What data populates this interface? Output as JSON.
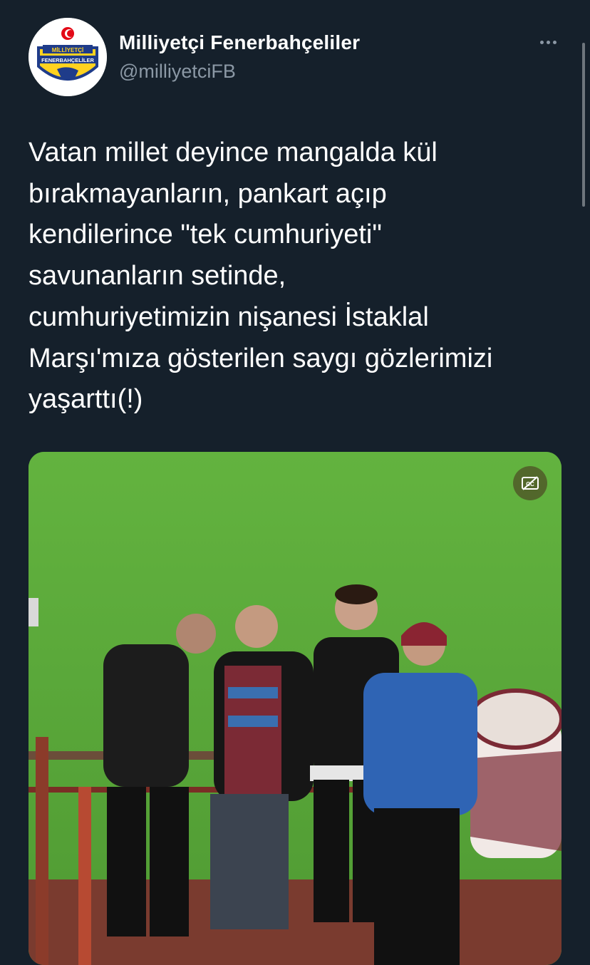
{
  "author": {
    "display_name": "Milliyetçi Fenerbahçeliler",
    "handle": "@milliyetciFB",
    "avatar_text_top": "MİLLİYETÇİ",
    "avatar_text_band": "FENERBAHÇELİLER"
  },
  "tweet": {
    "text": "Vatan millet deyince mangalda kül\nbırakmayanların, pankart açıp\nkendilerince \"tek cumhuriyeti\"\nsavunanların setinde,\ncumhuriyetimizin nişanesi İstaklal\nMarşı'mıza gösterilen saygı gözlerimizi\nyaşarttı(!)"
  },
  "icons": {
    "more": "more-horizontal-icon",
    "captions": "captions-off-icon"
  },
  "colors": {
    "background": "#15202b",
    "secondary_text": "#8b98a5",
    "pitch": "#5aa83a"
  }
}
